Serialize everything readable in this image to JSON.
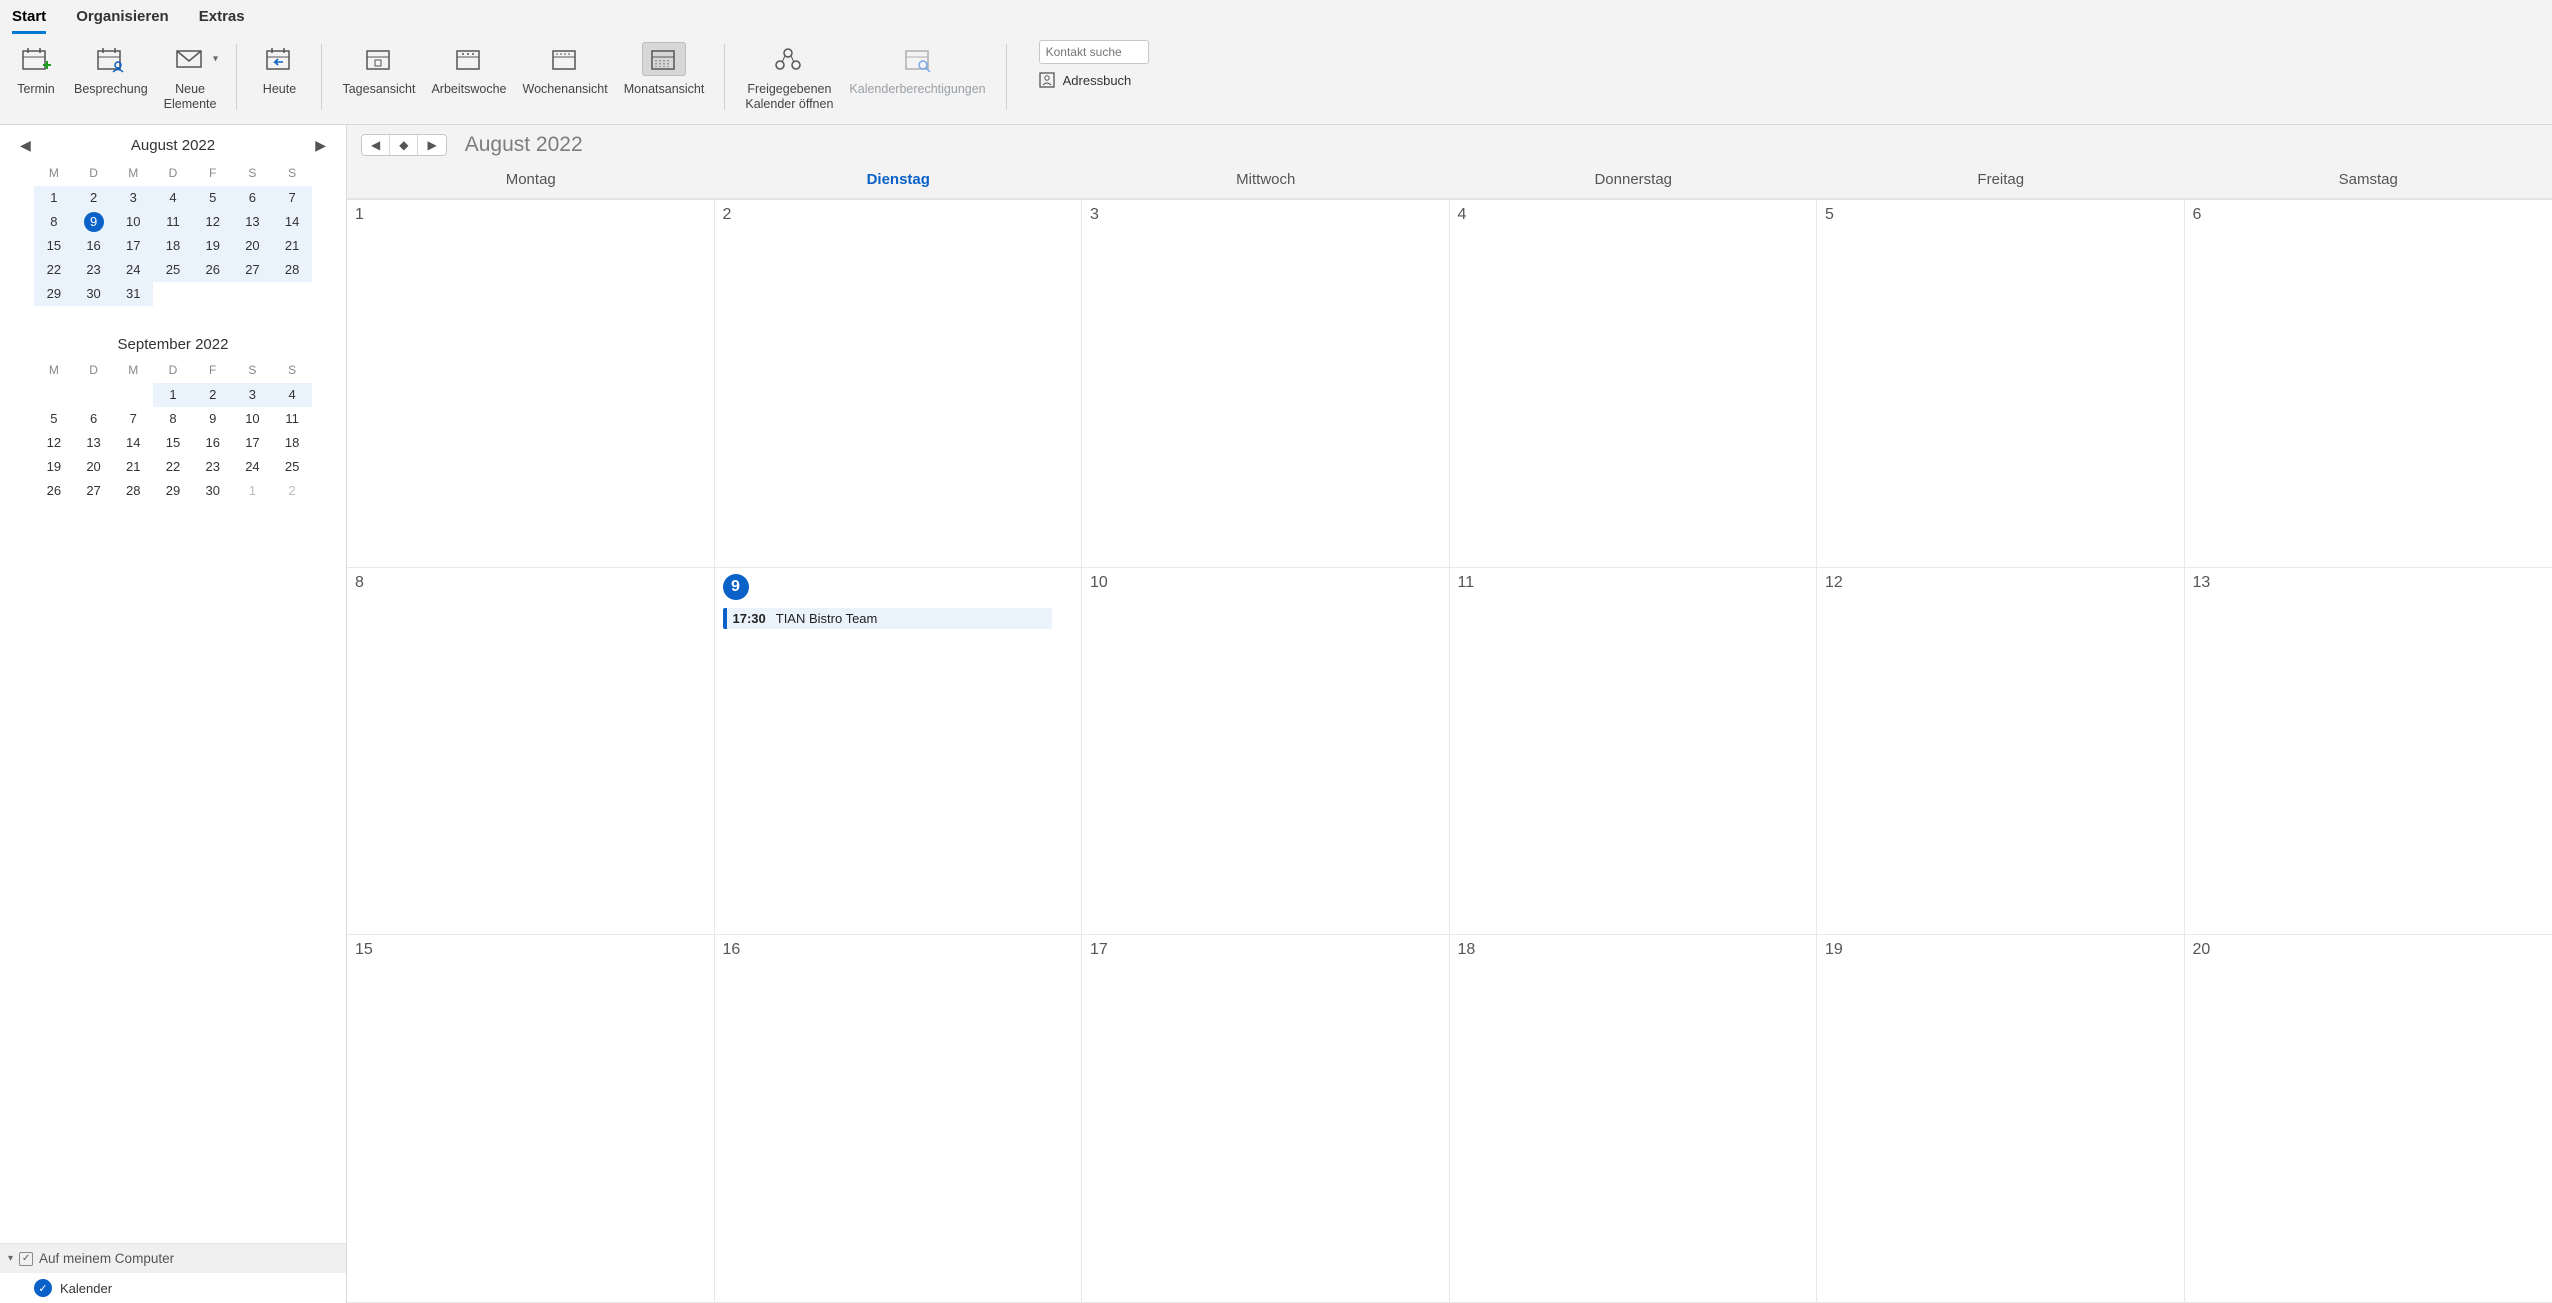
{
  "tabs": {
    "start": "Start",
    "organize": "Organisieren",
    "extras": "Extras",
    "active": "start"
  },
  "ribbon": {
    "termin": "Termin",
    "besprechung": "Besprechung",
    "neue_elemente": "Neue\nElemente",
    "heute": "Heute",
    "tagesansicht": "Tagesansicht",
    "arbeitswoche": "Arbeitswoche",
    "wochenansicht": "Wochenansicht",
    "monatsansicht": "Monatsansicht",
    "freigegeben": "Freigegebenen\nKalender öffnen",
    "berechtigungen": "Kalenderberechtigungen",
    "search_placeholder": "Kontakt suche",
    "adressbuch": "Adressbuch"
  },
  "mini1": {
    "title": "August 2022",
    "dow": [
      "M",
      "D",
      "M",
      "D",
      "F",
      "S",
      "S"
    ],
    "cells": [
      {
        "n": "1",
        "cls": "range"
      },
      {
        "n": "2",
        "cls": "range"
      },
      {
        "n": "3",
        "cls": "range"
      },
      {
        "n": "4",
        "cls": "range"
      },
      {
        "n": "5",
        "cls": "range"
      },
      {
        "n": "6",
        "cls": "range"
      },
      {
        "n": "7",
        "cls": "range"
      },
      {
        "n": "8",
        "cls": "range"
      },
      {
        "n": "9",
        "cls": "range today"
      },
      {
        "n": "10",
        "cls": "range"
      },
      {
        "n": "11",
        "cls": "range"
      },
      {
        "n": "12",
        "cls": "range"
      },
      {
        "n": "13",
        "cls": "range"
      },
      {
        "n": "14",
        "cls": "range"
      },
      {
        "n": "15",
        "cls": "range"
      },
      {
        "n": "16",
        "cls": "range"
      },
      {
        "n": "17",
        "cls": "range"
      },
      {
        "n": "18",
        "cls": "range"
      },
      {
        "n": "19",
        "cls": "range"
      },
      {
        "n": "20",
        "cls": "range"
      },
      {
        "n": "21",
        "cls": "range"
      },
      {
        "n": "22",
        "cls": "range"
      },
      {
        "n": "23",
        "cls": "range"
      },
      {
        "n": "24",
        "cls": "range"
      },
      {
        "n": "25",
        "cls": "range"
      },
      {
        "n": "26",
        "cls": "range"
      },
      {
        "n": "27",
        "cls": "range"
      },
      {
        "n": "28",
        "cls": "range"
      },
      {
        "n": "29",
        "cls": "range"
      },
      {
        "n": "30",
        "cls": "range"
      },
      {
        "n": "31",
        "cls": "range"
      },
      {
        "n": "",
        "cls": ""
      },
      {
        "n": "",
        "cls": ""
      },
      {
        "n": "",
        "cls": ""
      },
      {
        "n": "",
        "cls": ""
      }
    ]
  },
  "mini2": {
    "title": "September 2022",
    "dow": [
      "M",
      "D",
      "M",
      "D",
      "F",
      "S",
      "S"
    ],
    "cells": [
      {
        "n": "",
        "cls": ""
      },
      {
        "n": "",
        "cls": ""
      },
      {
        "n": "",
        "cls": ""
      },
      {
        "n": "1",
        "cls": "range"
      },
      {
        "n": "2",
        "cls": "range"
      },
      {
        "n": "3",
        "cls": "range"
      },
      {
        "n": "4",
        "cls": "range"
      },
      {
        "n": "5",
        "cls": ""
      },
      {
        "n": "6",
        "cls": ""
      },
      {
        "n": "7",
        "cls": ""
      },
      {
        "n": "8",
        "cls": ""
      },
      {
        "n": "9",
        "cls": ""
      },
      {
        "n": "10",
        "cls": ""
      },
      {
        "n": "11",
        "cls": ""
      },
      {
        "n": "12",
        "cls": ""
      },
      {
        "n": "13",
        "cls": ""
      },
      {
        "n": "14",
        "cls": ""
      },
      {
        "n": "15",
        "cls": ""
      },
      {
        "n": "16",
        "cls": ""
      },
      {
        "n": "17",
        "cls": ""
      },
      {
        "n": "18",
        "cls": ""
      },
      {
        "n": "19",
        "cls": ""
      },
      {
        "n": "20",
        "cls": ""
      },
      {
        "n": "21",
        "cls": ""
      },
      {
        "n": "22",
        "cls": ""
      },
      {
        "n": "23",
        "cls": ""
      },
      {
        "n": "24",
        "cls": ""
      },
      {
        "n": "25",
        "cls": ""
      },
      {
        "n": "26",
        "cls": ""
      },
      {
        "n": "27",
        "cls": ""
      },
      {
        "n": "28",
        "cls": ""
      },
      {
        "n": "29",
        "cls": ""
      },
      {
        "n": "30",
        "cls": ""
      },
      {
        "n": "1",
        "cls": "dim"
      },
      {
        "n": "2",
        "cls": "dim"
      }
    ]
  },
  "tree": {
    "group": "Auf meinem Computer",
    "item": "Kalender"
  },
  "calendar": {
    "title": "August 2022",
    "dow": [
      "Montag",
      "Dienstag",
      "Mittwoch",
      "Donnerstag",
      "Freitag",
      "Samstag"
    ],
    "today_index": 1,
    "weeks": [
      [
        {
          "n": "1"
        },
        {
          "n": "2"
        },
        {
          "n": "3"
        },
        {
          "n": "4"
        },
        {
          "n": "5"
        },
        {
          "n": "6"
        }
      ],
      [
        {
          "n": "8"
        },
        {
          "n": "9",
          "today": true,
          "events": [
            {
              "time": "17:30",
              "title": "TIAN Bistro Team"
            }
          ]
        },
        {
          "n": "10"
        },
        {
          "n": "11"
        },
        {
          "n": "12"
        },
        {
          "n": "13"
        }
      ],
      [
        {
          "n": "15"
        },
        {
          "n": "16"
        },
        {
          "n": "17"
        },
        {
          "n": "18"
        },
        {
          "n": "19"
        },
        {
          "n": "20"
        }
      ]
    ]
  }
}
